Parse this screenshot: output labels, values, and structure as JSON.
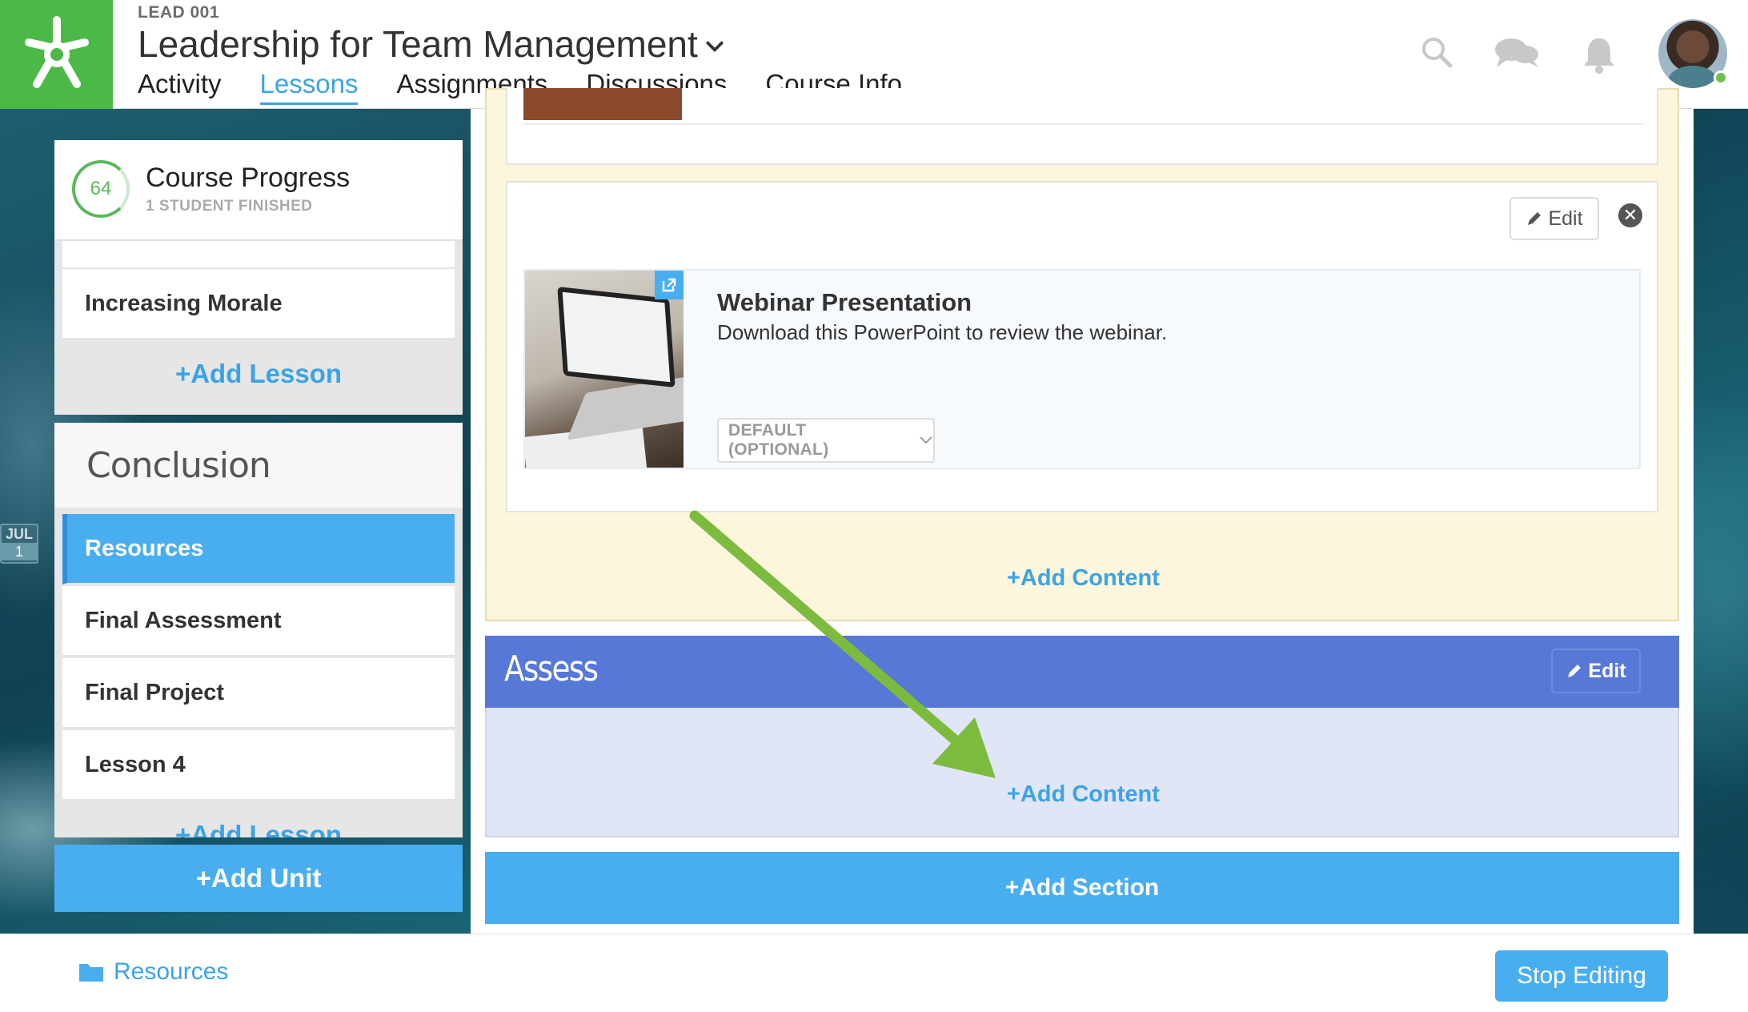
{
  "header": {
    "course_code": "LEAD 001",
    "course_title": "Leadership for Team Management",
    "tabs": [
      {
        "label": "Activity",
        "active": false
      },
      {
        "label": "Lessons",
        "active": true
      },
      {
        "label": "Assignments",
        "active": false
      },
      {
        "label": "Discussions",
        "active": false
      },
      {
        "label": "Course Info",
        "active": false
      }
    ],
    "icons": [
      "search-icon",
      "chat-icon",
      "bell-icon"
    ]
  },
  "sidebar": {
    "progress": {
      "value": "64",
      "title": "Course Progress",
      "subtitle": "1 STUDENT FINISHED"
    },
    "unit1": {
      "lessons": [
        "Increasing Morale"
      ],
      "add_lesson": "+Add Lesson"
    },
    "unit2": {
      "title": "Conclusion",
      "lessons": [
        "Resources",
        "Final Assessment",
        "Final Project",
        "Lesson 4"
      ],
      "active_lesson": "Resources",
      "add_lesson": "+Add Lesson"
    },
    "add_unit": "+Add Unit",
    "calendar": {
      "month": "JUL",
      "day": "1"
    }
  },
  "main": {
    "section1": {
      "content_item": {
        "title": "Webinar Presentation",
        "description": "Download this PowerPoint to review the webinar.",
        "select_value": "DEFAULT (OPTIONAL)"
      },
      "edit_label": "Edit",
      "add_content": "+Add Content"
    },
    "section2": {
      "title": "Assess",
      "edit_label": "Edit",
      "add_content": "+Add Content"
    },
    "add_section": "+Add Section"
  },
  "footer": {
    "resources_link": "Resources",
    "stop_editing": "Stop Editing"
  },
  "colors": {
    "brand_green": "#4cb848",
    "accent_blue": "#49aef0",
    "assess_header": "#5778d6",
    "annotation_arrow": "#7dbb3f"
  }
}
